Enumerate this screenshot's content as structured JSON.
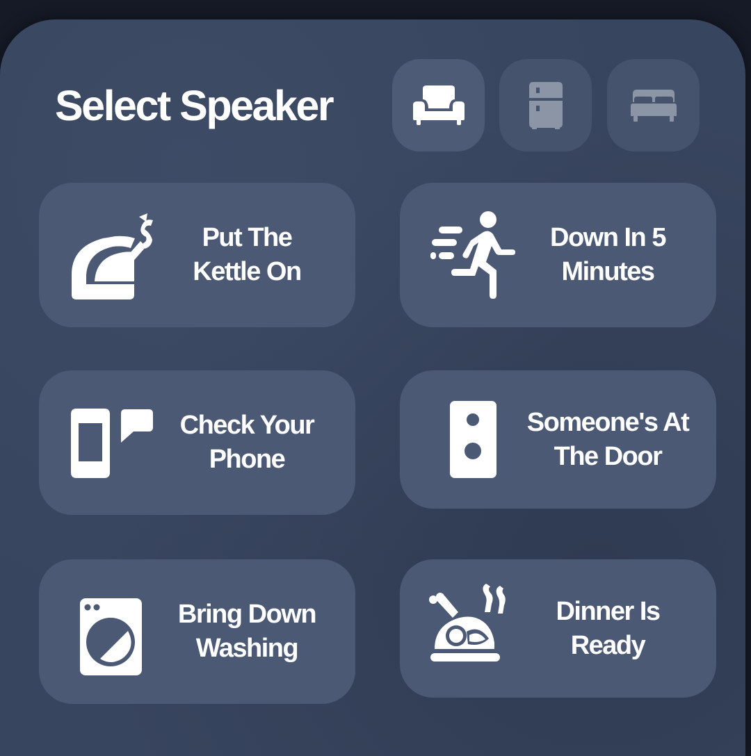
{
  "header": {
    "title": "Select Speaker"
  },
  "speakers": [
    {
      "icon": "sofa-icon",
      "room": "living room",
      "selected": true
    },
    {
      "icon": "fridge-icon",
      "room": "kitchen",
      "selected": false
    },
    {
      "icon": "bed-icon",
      "room": "bedroom",
      "selected": false
    }
  ],
  "messages": [
    {
      "icon": "kettle-icon",
      "line1": "Put The",
      "line2": "Kettle On"
    },
    {
      "icon": "running-person-icon",
      "line1": "Down In 5",
      "line2": "Minutes"
    },
    {
      "icon": "phone-message-icon",
      "line1": "Check Your",
      "line2": "Phone"
    },
    {
      "icon": "doorbell-icon",
      "line1": "Someone's At",
      "line2": "The Door"
    },
    {
      "icon": "washing-machine-icon",
      "line1": "Bring Down",
      "line2": "Washing"
    },
    {
      "icon": "roast-turkey-icon",
      "line1": "Dinner Is",
      "line2": "Ready"
    }
  ],
  "colors": {
    "background": "#151a26",
    "card": "#38455e",
    "tile": "#4b5974",
    "speaker_button": "#45536d",
    "speaker_button_selected": "#4d5b77",
    "icon_active": "#ffffff",
    "icon_inactive": "#8c95a6",
    "text": "#ffffff"
  }
}
